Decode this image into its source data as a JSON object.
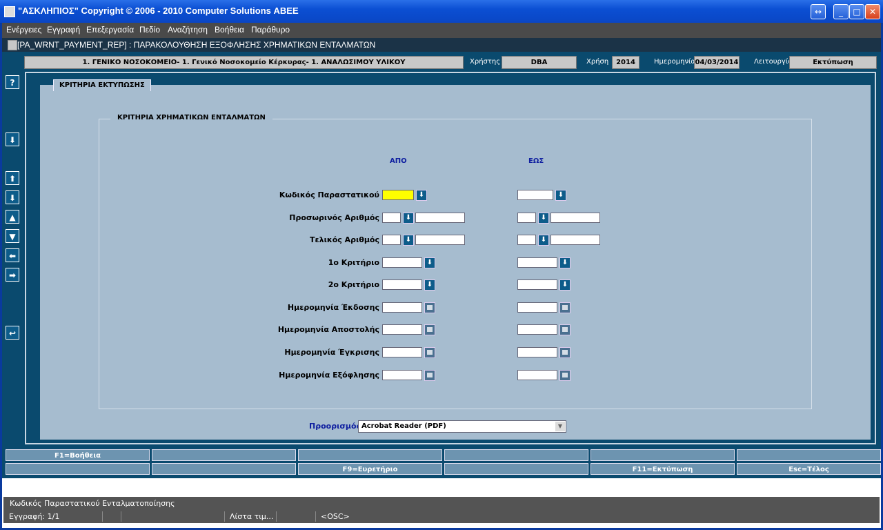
{
  "window": {
    "title": "\"ΑΣΚΛΗΠΙΟΣ\" Copyright © 2006 - 2010 Computer Solutions ΑΒΕΕ",
    "buttons": {
      "restore": "↔",
      "minimize": "_",
      "maximize": "□",
      "close": "✕"
    }
  },
  "menu": [
    "Ενέργειες",
    "Εγγραφή",
    "Επεξεργασία",
    "Πεδίο",
    "Αναζήτηση",
    "Βοήθεια",
    "Παράθυρο"
  ],
  "module": "[PA_WRNT_PAYMENT_REP]  :  ΠΑΡΑΚΟΛΟΥΘΗΣΗ ΕΞΟΦΛΗΣΗΣ ΧΡΗΜΑΤΙΚΩΝ ΕΝΤΑΛΜΑΤΩΝ",
  "header": {
    "organization": "1. ΓΕΝΙΚΟ ΝΟΣΟΚΟΜΕΙΟ- 1. Γενικό Νοσοκομείο Κέρκυρας- 1. ΑΝΑΛΩΣΙΜΟΥ ΥΛΙΚΟΥ",
    "user_label": "Χρήστης",
    "user": "DBA",
    "year_label": "Χρήση",
    "year": "2014",
    "date_label": "Ημερομηνία",
    "date": "04/03/2014",
    "function_label": "Λειτουργία",
    "function": "Εκτύπωση"
  },
  "toolbar": {
    "help": "?",
    "lov": "⬇",
    "first": "⬆",
    "next_block": "⬇",
    "prev_record": "▲",
    "next_record": "▼",
    "prev": "⬅",
    "next": "➡",
    "exit": "↩"
  },
  "tab_title": "ΚΡΙΤΗΡΙΑ ΕΚΤΥΠΩΣΗΣ",
  "group_title": "ΚΡΙΤΗΡΙΑ ΧΡΗΜΑΤΙΚΩΝ ΕΝΤΑΛΜΑΤΩΝ",
  "col_from": "ΑΠΟ",
  "col_to": "ΕΩΣ",
  "fields": [
    {
      "label": "Κωδικός Παραστατικού",
      "kind": "lov"
    },
    {
      "label": "Προσωρινός Αριθμός",
      "kind": "lov2"
    },
    {
      "label": "Τελικός Αριθμός",
      "kind": "lov2"
    },
    {
      "label": "1ο Κριτήριο",
      "kind": "lov"
    },
    {
      "label": "2ο Κριτήριο",
      "kind": "lov"
    },
    {
      "label": "Ημερομηνία Έκδοσης",
      "kind": "date"
    },
    {
      "label": "Ημερομηνία Αποστολής",
      "kind": "date"
    },
    {
      "label": "Ημερομηνία Έγκρισης",
      "kind": "date"
    },
    {
      "label": "Ημερομηνία Εξόφλησης",
      "kind": "date"
    }
  ],
  "destination": {
    "label": "Προορισμός",
    "value": "Acrobat Reader (PDF)"
  },
  "fkeys_row1": [
    "F1=Βοήθεια",
    "",
    "",
    "",
    "",
    ""
  ],
  "fkeys_row2": [
    "",
    "",
    "F9=Ευρετήριο",
    "",
    "F11=Εκτύπωση",
    "Esc=Τέλος"
  ],
  "status": {
    "hint": "Κωδικός Παραστατικού Ενταλματοποίησης",
    "record": "Εγγραφή: 1/1",
    "list": "Λίστα τιμ...",
    "osc": "<OSC>"
  },
  "colors": {
    "active_field": "#ffff00",
    "panel": "#a6bccf",
    "workarea": "#0a4a6e"
  }
}
